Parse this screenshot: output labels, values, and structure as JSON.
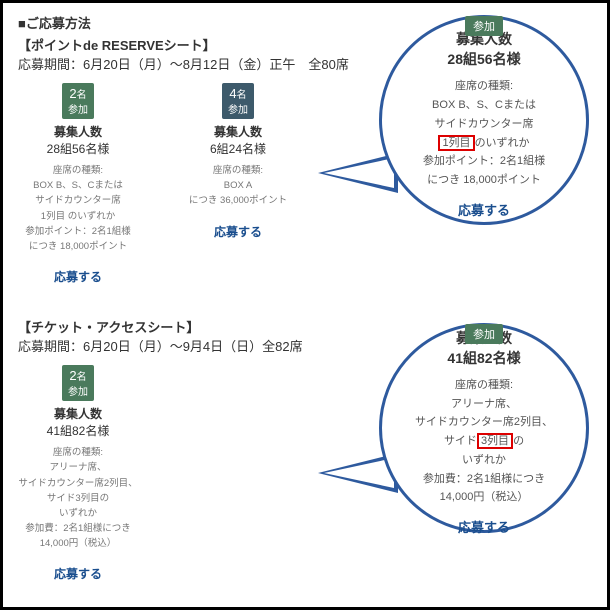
{
  "main_title": "■ご応募方法",
  "sec1": {
    "subtitle": "【ポイントde RESERVEシート】",
    "period": "応募期間：6月20日（月）～8月12日（金）正午　全80席",
    "card1": {
      "badge_num": "2",
      "badge_suffix": "名",
      "badge_line2": "参加",
      "title": "募集人数",
      "sub": "28組56名様",
      "l1": "座席の種類:",
      "l2": "BOX B、S、Cまたは",
      "l3": "サイドカウンター席",
      "l4": "1列目 のいずれか",
      "l5": "参加ポイント：2名1組様",
      "l6": "につき 18,000ポイント",
      "apply": "応募する"
    },
    "card2": {
      "badge_num": "4",
      "badge_suffix": "名",
      "badge_line2": "参加",
      "title": "募集人数",
      "sub": "6組24名様",
      "l1": "座席の種類:",
      "l2": "BOX A",
      "l3": "",
      "l4": "",
      "l5": "",
      "l6": "につき 36,000ポイント",
      "apply": "応募する"
    }
  },
  "callout1": {
    "badge": "参加",
    "title": "募集人数",
    "sub": "28組56名様",
    "l1": "座席の種類:",
    "l2": "BOX B、S、Cまたは",
    "l3": "サイドカウンター席",
    "l4a": "1列目",
    "l4b": "のいずれか",
    "l5": "参加ポイント：2名1組様",
    "l6": "につき 18,000ポイント",
    "apply": "応募する"
  },
  "sec2": {
    "subtitle": "【チケット・アクセスシート】",
    "period": "応募期間：6月20日（月）～9月4日（日）全82席",
    "card1": {
      "badge_num": "2",
      "badge_suffix": "名",
      "badge_line2": "参加",
      "title": "募集人数",
      "sub": "41組82名様",
      "l1": "座席の種類:",
      "l2": "アリーナ席、",
      "l3": "サイドカウンター席2列目、",
      "l4": "サイド3列目の",
      "l5": "いずれか",
      "l6": "参加費：2名1組様につき",
      "l7": "14,000円（税込）",
      "apply": "応募する"
    }
  },
  "callout2": {
    "badge": "参加",
    "title": "募集人数",
    "sub": "41組82名様",
    "l1": "座席の種類:",
    "l2": "アリーナ席、",
    "l3": "サイドカウンター席2列目、",
    "l4a": "サイド",
    "l4b": "3列目",
    "l4c": "の",
    "l5": "いずれか",
    "l6": "参加費：2名1組様につき",
    "l7": "14,000円（税込）",
    "apply": "応募する"
  }
}
